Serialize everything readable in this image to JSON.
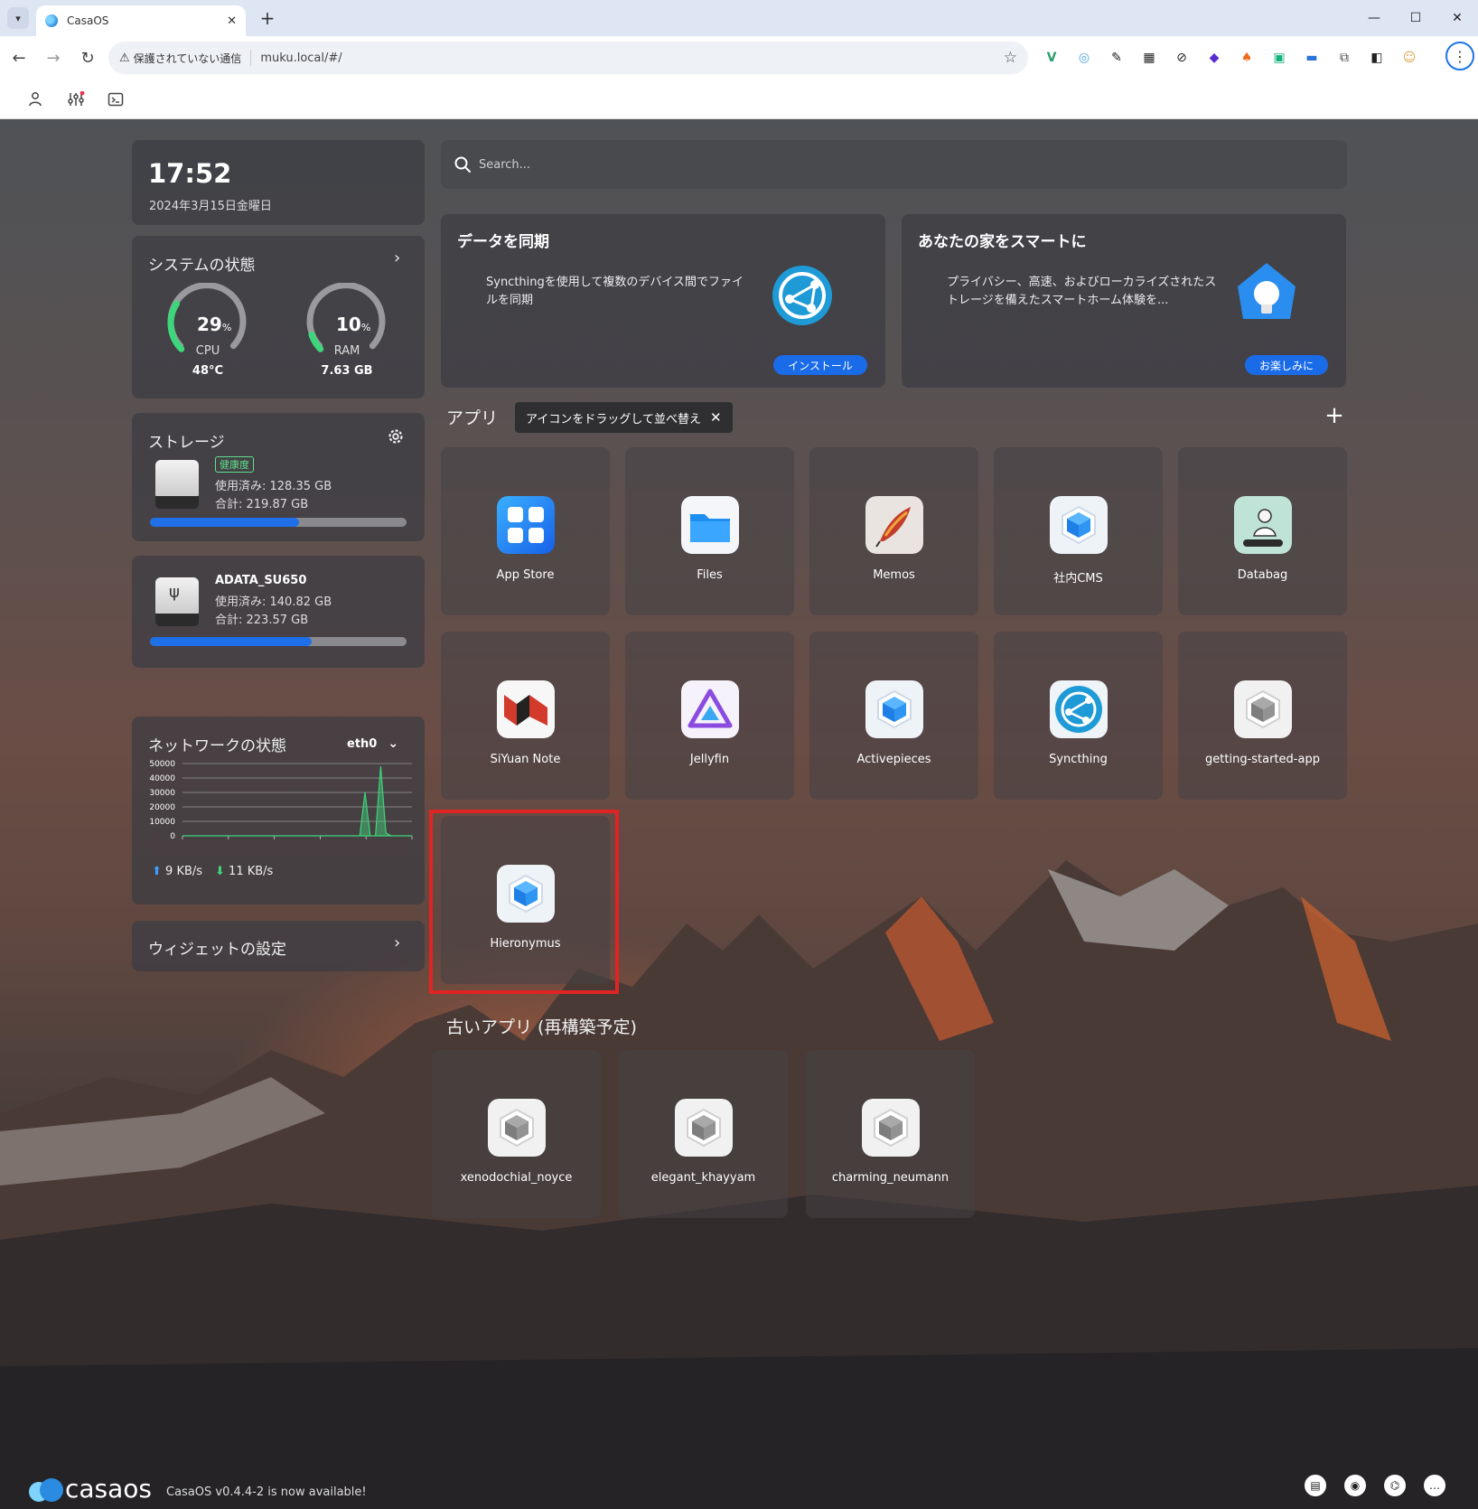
{
  "browser": {
    "tab_title": "CasaOS",
    "security_label": "保護されていない通信",
    "url": "muku.local/#/"
  },
  "clock": {
    "time": "17:52",
    "date": "2024年3月15日金曜日"
  },
  "system": {
    "title": "システムの状態",
    "cpu": {
      "value": "29",
      "unit": "%",
      "label": "CPU",
      "sub": "48°C",
      "percent": 29
    },
    "ram": {
      "value": "10",
      "unit": "%",
      "label": "RAM",
      "sub": "7.63 GB",
      "percent": 10
    }
  },
  "storage": {
    "title": "ストレージ",
    "disks": [
      {
        "name": "",
        "badge": "健康度",
        "used": "使用済み: 128.35 GB",
        "total": "合計: 219.87 GB",
        "fraction": 0.58
      },
      {
        "name": "ADATA_SU650",
        "badge": "",
        "used": "使用済み: 140.82 GB",
        "total": "合計: 223.57 GB",
        "fraction": 0.63
      }
    ]
  },
  "network": {
    "title": "ネットワークの状態",
    "interface": "eth0",
    "upload": "9 KB/s",
    "download": "11 KB/s",
    "chart_data": {
      "type": "area",
      "yticks": [
        "50000",
        "40000",
        "30000",
        "20000",
        "10000",
        "0"
      ],
      "ylim": [
        0,
        50000
      ],
      "series": [
        {
          "values": [
            0,
            0,
            0,
            0,
            0,
            0,
            0,
            0,
            0,
            0,
            0,
            0,
            0,
            0,
            0,
            0,
            0,
            0,
            0,
            0,
            0,
            0,
            0,
            0,
            0,
            0,
            0,
            0,
            0,
            0,
            0,
            0,
            0,
            0,
            0,
            30000,
            0,
            0,
            48000,
            2000,
            0,
            0,
            0,
            0,
            0
          ]
        }
      ]
    }
  },
  "widgets": {
    "title": "ウィジェットの設定"
  },
  "search": {
    "placeholder": "Search..."
  },
  "promos": [
    {
      "title": "データを同期",
      "desc": "Syncthingを使用して複数のデバイス間でファイルを同期",
      "button": "インストール"
    },
    {
      "title": "あなたの家をスマートに",
      "desc": "プライバシー、高速、およびローカライズされたストレージを備えたスマートホーム体験を...",
      "button": "お楽しみに"
    }
  ],
  "apps_section": {
    "title": "アプリ",
    "hint": "アイコンをドラッグして並べ替え"
  },
  "apps": [
    {
      "label": "App Store",
      "icon": "app-store-icon"
    },
    {
      "label": "Files",
      "icon": "folder-icon"
    },
    {
      "label": "Memos",
      "icon": "feather-icon"
    },
    {
      "label": "社内CMS",
      "icon": "cube-icon"
    },
    {
      "label": "Databag",
      "icon": "databag-icon"
    },
    {
      "label": "SiYuan Note",
      "icon": "siyuan-icon"
    },
    {
      "label": "Jellyfin",
      "icon": "jellyfin-icon"
    },
    {
      "label": "Activepieces",
      "icon": "cube-icon"
    },
    {
      "label": "Syncthing",
      "icon": "syncthing-icon"
    },
    {
      "label": "getting-started-app",
      "icon": "grey-cube-icon"
    },
    {
      "label": "Hieronymus",
      "icon": "cube-icon"
    }
  ],
  "legacy_section": {
    "title": "古いアプリ (再構築予定)"
  },
  "legacy_apps": [
    {
      "label": "xenodochial_noyce",
      "icon": "grey-cube-icon"
    },
    {
      "label": "elegant_khayyam",
      "icon": "grey-cube-icon"
    },
    {
      "label": "charming_neumann",
      "icon": "grey-cube-icon"
    }
  ],
  "footer": {
    "brand": "casaos",
    "message": "CasaOS v0.4.4-2 is now available!"
  }
}
